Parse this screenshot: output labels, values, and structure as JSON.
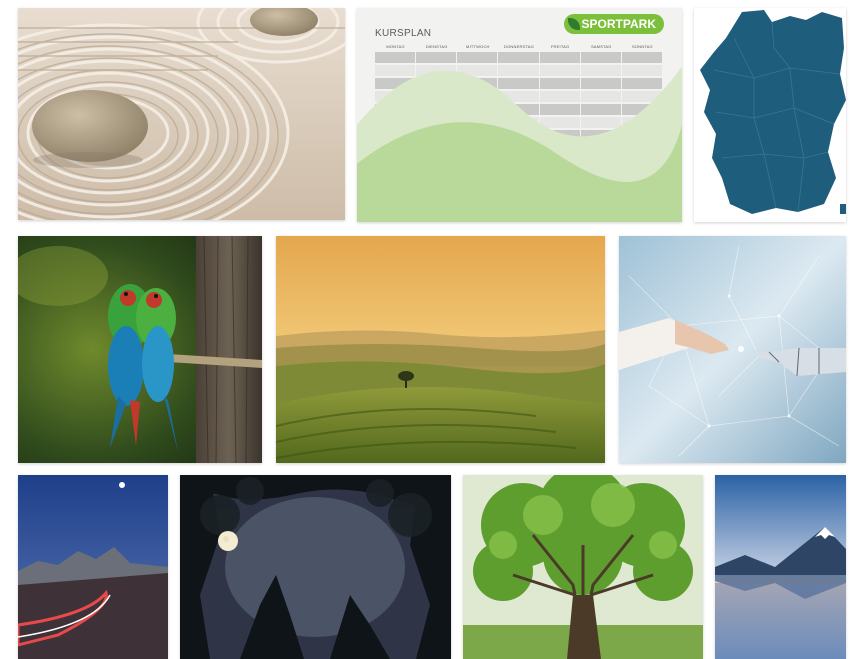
{
  "gallery": {
    "kursplan": {
      "title": "KURSPLAN",
      "logo_text": "SPORTPARK",
      "days": [
        "MONTAG",
        "DIENSTAG",
        "MITTWOCH",
        "DONNERSTAG",
        "FREITAG",
        "SAMSTAG",
        "SONNTAG"
      ]
    },
    "icons": {
      "logo": "leaf-icon"
    },
    "colors": {
      "kursplan_accent": "#7cbf3b",
      "map_fill": "#1f5d7c"
    }
  }
}
